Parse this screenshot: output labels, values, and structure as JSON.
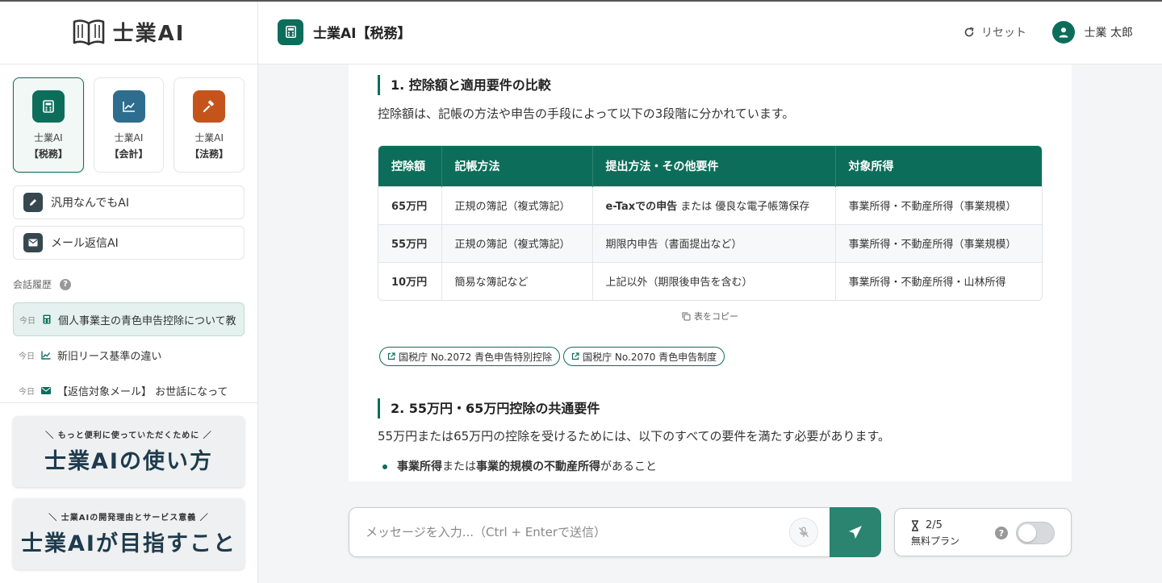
{
  "brand": {
    "name": "士業AI"
  },
  "modes": [
    {
      "line1": "士業AI",
      "line2": "【税務】",
      "color": "#0c6e5a",
      "icon": "calculator-icon"
    },
    {
      "line1": "士業AI",
      "line2": "【会計】",
      "color": "#2e6d8e",
      "icon": "chart-line-icon"
    },
    {
      "line1": "士業AI",
      "line2": "【法務】",
      "color": "#c5541c",
      "icon": "gavel-icon"
    }
  ],
  "tools": [
    {
      "label": "汎用なんでもAI",
      "icon": "pen-icon"
    },
    {
      "label": "メール返信AI",
      "icon": "envelope-icon"
    }
  ],
  "history": {
    "heading": "会話履歴",
    "help": "?",
    "items": [
      {
        "day": "今日",
        "title": "個人事業主の青色申告控除について教",
        "icon": "calculator-icon"
      },
      {
        "day": "今日",
        "title": "新旧リース基準の違い",
        "icon": "chart-line-icon"
      },
      {
        "day": "今日",
        "title": "【返信対象メール】 お世話になって",
        "icon": "envelope-icon"
      }
    ]
  },
  "banners": [
    {
      "sub": "＼ もっと便利に使っていただくために ／",
      "title": "士業AIの使い方"
    },
    {
      "sub": "＼ 士業AIの開発理由とサービス意義 ／",
      "title": "士業AIが目指すこと"
    }
  ],
  "header": {
    "title": "士業AI【税務】",
    "reset": "リセット",
    "user": "士業 太郎"
  },
  "content": {
    "section1": {
      "heading": "1. 控除額と適用要件の比較",
      "intro": "控除額は、記帳の方法や申告の手段によって以下の3段階に分かれています。"
    },
    "table": {
      "headers": [
        "控除額",
        "記帳方法",
        "提出方法・その他要件",
        "対象所得"
      ],
      "rows": [
        {
          "amount": "65万円",
          "method": "正規の簿記（複式簿記）",
          "req_bold": "e-Taxでの申告",
          "req_rest": " または 優良な電子帳簿保存",
          "income": "事業所得・不動産所得（事業規模）"
        },
        {
          "amount": "55万円",
          "method": "正規の簿記（複式簿記）",
          "req_bold": "",
          "req_rest": "期限内申告（書面提出など）",
          "income": "事業所得・不動産所得（事業規模）"
        },
        {
          "amount": "10万円",
          "method": "簡易な簿記など",
          "req_bold": "",
          "req_rest": "上記以外（期限後申告を含む）",
          "income": "事業所得・不動産所得・山林所得"
        }
      ],
      "copy_label": "表をコピー"
    },
    "links": [
      "国税庁 No.2072 青色申告特別控除",
      "国税庁 No.2070 青色申告制度"
    ],
    "section2": {
      "heading": "2. 55万円・65万円控除の共通要件",
      "intro": "55万円または65万円の控除を受けるためには、以下のすべての要件を満たす必要があります。",
      "bullet_b1": "事業所得",
      "bullet_t1": "または",
      "bullet_b2": "事業的規模の不動産所得",
      "bullet_t2": "があること"
    }
  },
  "composer": {
    "placeholder": "メッセージを入力...（Ctrl + Enterで送信）"
  },
  "quota": {
    "count": "2/5",
    "plan": "無料プラン",
    "help": "?",
    "toggle_on": false
  },
  "colors": {
    "accent": "#0c6e5a",
    "send": "#2b8470"
  }
}
